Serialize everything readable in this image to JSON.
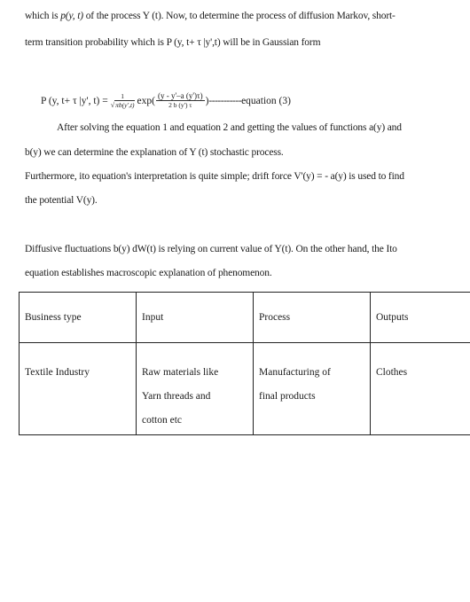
{
  "paragraphs": {
    "p1_line1_a": "which is ",
    "p1_line1_math": "p(y, t)",
    "p1_line1_b": " of the process Y (t).  Now, to determine the process of diffusion Markov, short-",
    "p1_line2": "term transition probability which is P (y, t+ τ |y',t) will be in Gaussian form",
    "p2_line1": "After solving the equation 1 and equation 2 and getting the values of functions a(y) and",
    "p2_line2": "b(y) we can determine the explanation of Y (t) stochastic process.",
    "p3_line1": "Furthermore, ito equation's interpretation is quite simple; drift force V'(y) = - a(y) is used to find",
    "p3_line2": "the potential V(y).",
    "p4_line1": "Diffusive fluctuations b(y) dW(t) is relying on current value of Y(t). On the other hand, the Ito",
    "p4_line2": "equation establishes macroscopic explanation of phenomenon."
  },
  "equation": {
    "lhs": "P (y, t+ τ |y', t) =",
    "frac1_num": "1",
    "frac1_den_sqrt": "√",
    "frac1_den": "πb(y',t)",
    "exp": "exp(",
    "frac2_num": "(y - y'–a (y')τ)",
    "frac2_den": "2 b (y') τ",
    "close": ")",
    "dashes": "-----------",
    "label": "equation (3)"
  },
  "table": {
    "headers": [
      "Business type",
      "Input",
      "Process",
      "Outputs"
    ],
    "rows": [
      {
        "business_type": [
          "Textile Industry"
        ],
        "input": [
          "Raw materials like",
          "Yarn threads and",
          "cotton etc"
        ],
        "process": [
          "Manufacturing of",
          "final products"
        ],
        "outputs": [
          "Clothes"
        ]
      }
    ]
  }
}
